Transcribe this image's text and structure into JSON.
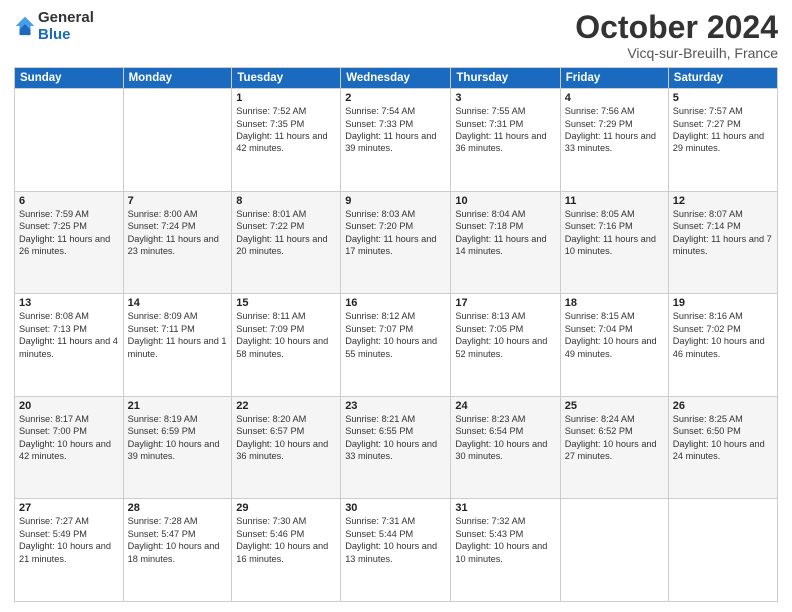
{
  "logo": {
    "general": "General",
    "blue": "Blue"
  },
  "header": {
    "month": "October 2024",
    "location": "Vicq-sur-Breuilh, France"
  },
  "days_of_week": [
    "Sunday",
    "Monday",
    "Tuesday",
    "Wednesday",
    "Thursday",
    "Friday",
    "Saturday"
  ],
  "weeks": [
    [
      {
        "day": "",
        "sunrise": "",
        "sunset": "",
        "daylight": ""
      },
      {
        "day": "",
        "sunrise": "",
        "sunset": "",
        "daylight": ""
      },
      {
        "day": "1",
        "sunrise": "Sunrise: 7:52 AM",
        "sunset": "Sunset: 7:35 PM",
        "daylight": "Daylight: 11 hours and 42 minutes."
      },
      {
        "day": "2",
        "sunrise": "Sunrise: 7:54 AM",
        "sunset": "Sunset: 7:33 PM",
        "daylight": "Daylight: 11 hours and 39 minutes."
      },
      {
        "day": "3",
        "sunrise": "Sunrise: 7:55 AM",
        "sunset": "Sunset: 7:31 PM",
        "daylight": "Daylight: 11 hours and 36 minutes."
      },
      {
        "day": "4",
        "sunrise": "Sunrise: 7:56 AM",
        "sunset": "Sunset: 7:29 PM",
        "daylight": "Daylight: 11 hours and 33 minutes."
      },
      {
        "day": "5",
        "sunrise": "Sunrise: 7:57 AM",
        "sunset": "Sunset: 7:27 PM",
        "daylight": "Daylight: 11 hours and 29 minutes."
      }
    ],
    [
      {
        "day": "6",
        "sunrise": "Sunrise: 7:59 AM",
        "sunset": "Sunset: 7:25 PM",
        "daylight": "Daylight: 11 hours and 26 minutes."
      },
      {
        "day": "7",
        "sunrise": "Sunrise: 8:00 AM",
        "sunset": "Sunset: 7:24 PM",
        "daylight": "Daylight: 11 hours and 23 minutes."
      },
      {
        "day": "8",
        "sunrise": "Sunrise: 8:01 AM",
        "sunset": "Sunset: 7:22 PM",
        "daylight": "Daylight: 11 hours and 20 minutes."
      },
      {
        "day": "9",
        "sunrise": "Sunrise: 8:03 AM",
        "sunset": "Sunset: 7:20 PM",
        "daylight": "Daylight: 11 hours and 17 minutes."
      },
      {
        "day": "10",
        "sunrise": "Sunrise: 8:04 AM",
        "sunset": "Sunset: 7:18 PM",
        "daylight": "Daylight: 11 hours and 14 minutes."
      },
      {
        "day": "11",
        "sunrise": "Sunrise: 8:05 AM",
        "sunset": "Sunset: 7:16 PM",
        "daylight": "Daylight: 11 hours and 10 minutes."
      },
      {
        "day": "12",
        "sunrise": "Sunrise: 8:07 AM",
        "sunset": "Sunset: 7:14 PM",
        "daylight": "Daylight: 11 hours and 7 minutes."
      }
    ],
    [
      {
        "day": "13",
        "sunrise": "Sunrise: 8:08 AM",
        "sunset": "Sunset: 7:13 PM",
        "daylight": "Daylight: 11 hours and 4 minutes."
      },
      {
        "day": "14",
        "sunrise": "Sunrise: 8:09 AM",
        "sunset": "Sunset: 7:11 PM",
        "daylight": "Daylight: 11 hours and 1 minute."
      },
      {
        "day": "15",
        "sunrise": "Sunrise: 8:11 AM",
        "sunset": "Sunset: 7:09 PM",
        "daylight": "Daylight: 10 hours and 58 minutes."
      },
      {
        "day": "16",
        "sunrise": "Sunrise: 8:12 AM",
        "sunset": "Sunset: 7:07 PM",
        "daylight": "Daylight: 10 hours and 55 minutes."
      },
      {
        "day": "17",
        "sunrise": "Sunrise: 8:13 AM",
        "sunset": "Sunset: 7:05 PM",
        "daylight": "Daylight: 10 hours and 52 minutes."
      },
      {
        "day": "18",
        "sunrise": "Sunrise: 8:15 AM",
        "sunset": "Sunset: 7:04 PM",
        "daylight": "Daylight: 10 hours and 49 minutes."
      },
      {
        "day": "19",
        "sunrise": "Sunrise: 8:16 AM",
        "sunset": "Sunset: 7:02 PM",
        "daylight": "Daylight: 10 hours and 46 minutes."
      }
    ],
    [
      {
        "day": "20",
        "sunrise": "Sunrise: 8:17 AM",
        "sunset": "Sunset: 7:00 PM",
        "daylight": "Daylight: 10 hours and 42 minutes."
      },
      {
        "day": "21",
        "sunrise": "Sunrise: 8:19 AM",
        "sunset": "Sunset: 6:59 PM",
        "daylight": "Daylight: 10 hours and 39 minutes."
      },
      {
        "day": "22",
        "sunrise": "Sunrise: 8:20 AM",
        "sunset": "Sunset: 6:57 PM",
        "daylight": "Daylight: 10 hours and 36 minutes."
      },
      {
        "day": "23",
        "sunrise": "Sunrise: 8:21 AM",
        "sunset": "Sunset: 6:55 PM",
        "daylight": "Daylight: 10 hours and 33 minutes."
      },
      {
        "day": "24",
        "sunrise": "Sunrise: 8:23 AM",
        "sunset": "Sunset: 6:54 PM",
        "daylight": "Daylight: 10 hours and 30 minutes."
      },
      {
        "day": "25",
        "sunrise": "Sunrise: 8:24 AM",
        "sunset": "Sunset: 6:52 PM",
        "daylight": "Daylight: 10 hours and 27 minutes."
      },
      {
        "day": "26",
        "sunrise": "Sunrise: 8:25 AM",
        "sunset": "Sunset: 6:50 PM",
        "daylight": "Daylight: 10 hours and 24 minutes."
      }
    ],
    [
      {
        "day": "27",
        "sunrise": "Sunrise: 7:27 AM",
        "sunset": "Sunset: 5:49 PM",
        "daylight": "Daylight: 10 hours and 21 minutes."
      },
      {
        "day": "28",
        "sunrise": "Sunrise: 7:28 AM",
        "sunset": "Sunset: 5:47 PM",
        "daylight": "Daylight: 10 hours and 18 minutes."
      },
      {
        "day": "29",
        "sunrise": "Sunrise: 7:30 AM",
        "sunset": "Sunset: 5:46 PM",
        "daylight": "Daylight: 10 hours and 16 minutes."
      },
      {
        "day": "30",
        "sunrise": "Sunrise: 7:31 AM",
        "sunset": "Sunset: 5:44 PM",
        "daylight": "Daylight: 10 hours and 13 minutes."
      },
      {
        "day": "31",
        "sunrise": "Sunrise: 7:32 AM",
        "sunset": "Sunset: 5:43 PM",
        "daylight": "Daylight: 10 hours and 10 minutes."
      },
      {
        "day": "",
        "sunrise": "",
        "sunset": "",
        "daylight": ""
      },
      {
        "day": "",
        "sunrise": "",
        "sunset": "",
        "daylight": ""
      }
    ]
  ]
}
